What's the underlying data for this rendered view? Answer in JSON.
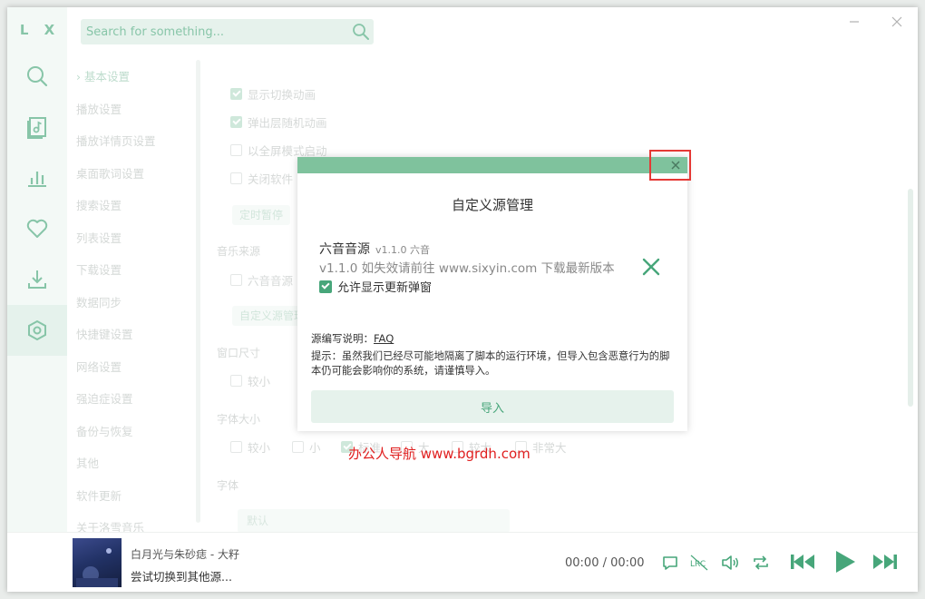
{
  "app": {
    "logo": "L X"
  },
  "search": {
    "placeholder": "Search for something..."
  },
  "menu": {
    "items": [
      "基本设置",
      "播放设置",
      "播放详情页设置",
      "桌面歌词设置",
      "搜索设置",
      "列表设置",
      "下载设置",
      "数据同步",
      "快捷键设置",
      "网络设置",
      "强迫症设置",
      "备份与恢复",
      "其他",
      "软件更新",
      "关于洛雪音乐"
    ],
    "active_index": 0
  },
  "content": {
    "opt_anim": "显示切换动画",
    "opt_popup_anim": "弹出层随机动画",
    "opt_fullscreen": "以全屏模式启动",
    "opt_close": "关闭软件",
    "timer_btn": "定时暂停",
    "music_source_head": "音乐来源",
    "source_option": "六音音源",
    "custom_source_btn": "自定义源管理",
    "window_size_head": "窗口尺寸",
    "size_smaller": "较小",
    "font_size_head": "字体大小",
    "fs_smaller": "较小",
    "fs_small": "小",
    "fs_standard": "标准",
    "fs_large": "大",
    "fs_larger": "较大",
    "fs_xlarge": "非常大",
    "font_head": "字体",
    "font_select": "默认"
  },
  "modal": {
    "title": "自定义源管理",
    "source": {
      "name": "六音音源",
      "version": "v1.1.0 六音",
      "description": "v1.1.0 如失效请前往 www.sixyin.com 下载最新版本",
      "allow_update_popup": "允许显示更新弹窗",
      "allow_update_checked": true
    },
    "doc_label": "源编写说明：",
    "doc_link": "FAQ",
    "tip": "提示：虽然我们已经尽可能地隔离了脚本的运行环境，但导入包含恶意行为的脚本仍可能会影响你的系统，请谨慎导入。",
    "import_button": "导入"
  },
  "watermark": "办公人导航  www.bgrdh.com",
  "player": {
    "song_title": "白月光与朱砂痣 - 大籽",
    "status": "尝试切换到其他源...",
    "time": "00:00 / 00:00",
    "lrc_label": "LRC"
  },
  "colors": {
    "accent": "#47a67a",
    "modal_bar": "#7fc29d",
    "highlight": "#e53935"
  }
}
